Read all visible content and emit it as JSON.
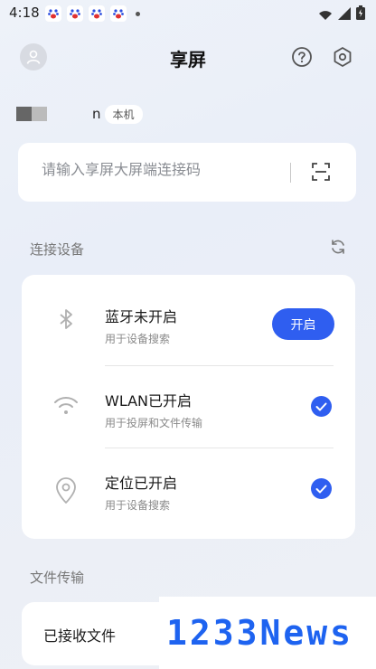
{
  "status_bar": {
    "time": "4:18"
  },
  "header": {
    "title": "享屏"
  },
  "device": {
    "name_suffix": "n",
    "badge": "本机"
  },
  "search": {
    "placeholder": "请输入享屏大屏端连接码"
  },
  "connect_section": {
    "label": "连接设备"
  },
  "devices": [
    {
      "title": "蓝牙未开启",
      "subtitle": "用于设备搜索",
      "action": "开启",
      "icon": "bluetooth-icon"
    },
    {
      "title": "WLAN已开启",
      "subtitle": "用于投屏和文件传输",
      "icon": "wifi-icon",
      "checked": true
    },
    {
      "title": "定位已开启",
      "subtitle": "用于设备搜索",
      "icon": "location-icon",
      "checked": true
    }
  ],
  "file_section": {
    "label": "文件传输"
  },
  "file_card": {
    "label": "已接收文件"
  },
  "watermark": {
    "text": "1233News"
  },
  "colors": {
    "accent": "#2f5ef0",
    "background": "#eef2f9"
  }
}
